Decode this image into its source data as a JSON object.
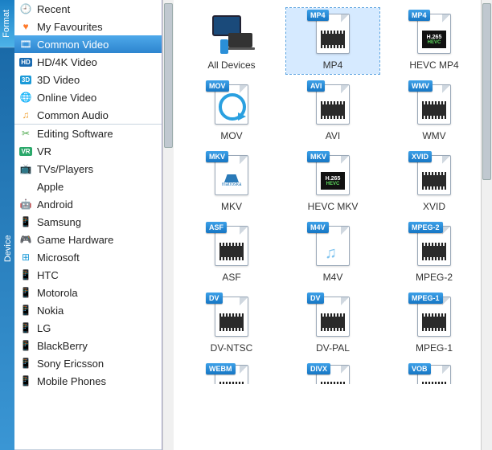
{
  "sidetabs": {
    "format": "Format",
    "device": "Device"
  },
  "format_items": [
    {
      "label": "Recent",
      "icon": "clock-icon",
      "color": "#f0a030"
    },
    {
      "label": "My Favourites",
      "icon": "heart-icon",
      "color": "#ff7a2a"
    },
    {
      "label": "Common Video",
      "icon": "film-icon",
      "color": "#ffffff",
      "selected": true
    },
    {
      "label": "HD/4K Video",
      "icon": "hd-badge-icon",
      "color": "#1a6ab0",
      "badge": "HD"
    },
    {
      "label": "3D Video",
      "icon": "3d-badge-icon",
      "color": "#1a9ad8",
      "badge": "3D"
    },
    {
      "label": "Online Video",
      "icon": "globe-icon",
      "color": "#e04a3a"
    },
    {
      "label": "Common Audio",
      "icon": "music-icon",
      "color": "#f0a030"
    }
  ],
  "device_items": [
    {
      "label": "Editing Software",
      "icon": "scissors-icon",
      "color": "#4aa84a"
    },
    {
      "label": "VR",
      "icon": "vr-badge-icon",
      "color": "#2aa86a",
      "badge": "VR"
    },
    {
      "label": "TVs/Players",
      "icon": "tv-icon",
      "color": "#f0a030"
    },
    {
      "label": "Apple",
      "icon": "apple-icon",
      "color": "#555"
    },
    {
      "label": "Android",
      "icon": "android-icon",
      "color": "#7cb342"
    },
    {
      "label": "Samsung",
      "icon": "phone-icon",
      "color": "#1a4a8a"
    },
    {
      "label": "Game Hardware",
      "icon": "gamepad-icon",
      "color": "#777"
    },
    {
      "label": "Microsoft",
      "icon": "windows-icon",
      "color": "#1a9ad8"
    },
    {
      "label": "HTC",
      "icon": "phone-icon",
      "color": "#222"
    },
    {
      "label": "Motorola",
      "icon": "phone-icon",
      "color": "#222"
    },
    {
      "label": "Nokia",
      "icon": "phone-icon",
      "color": "#1a5a9a"
    },
    {
      "label": "LG",
      "icon": "phone-icon",
      "color": "#222"
    },
    {
      "label": "BlackBerry",
      "icon": "phone-icon",
      "color": "#222"
    },
    {
      "label": "Sony Ericsson",
      "icon": "phone-icon",
      "color": "#1a5a9a"
    },
    {
      "label": "Mobile Phones",
      "icon": "phone-icon",
      "color": "#1a5a9a"
    }
  ],
  "formats": [
    {
      "label": "All Devices",
      "tag": "",
      "kind": "alldevices"
    },
    {
      "label": "MP4",
      "tag": "MP4",
      "kind": "film",
      "selected": true
    },
    {
      "label": "HEVC MP4",
      "tag": "MP4",
      "kind": "hevc"
    },
    {
      "label": "MOV",
      "tag": "MOV",
      "kind": "qt"
    },
    {
      "label": "AVI",
      "tag": "AVI",
      "kind": "film"
    },
    {
      "label": "WMV",
      "tag": "WMV",
      "kind": "film"
    },
    {
      "label": "MKV",
      "tag": "MKV",
      "kind": "mkv"
    },
    {
      "label": "HEVC MKV",
      "tag": "MKV",
      "kind": "hevc"
    },
    {
      "label": "XVID",
      "tag": "XVID",
      "kind": "film"
    },
    {
      "label": "ASF",
      "tag": "ASF",
      "kind": "film"
    },
    {
      "label": "M4V",
      "tag": "M4V",
      "kind": "note"
    },
    {
      "label": "MPEG-2",
      "tag": "MPEG-2",
      "kind": "film"
    },
    {
      "label": "DV-NTSC",
      "tag": "DV",
      "kind": "film"
    },
    {
      "label": "DV-PAL",
      "tag": "DV",
      "kind": "film"
    },
    {
      "label": "MPEG-1",
      "tag": "MPEG-1",
      "kind": "film"
    },
    {
      "label": "",
      "tag": "WEBM",
      "kind": "film",
      "partial": true
    },
    {
      "label": "",
      "tag": "DIVX",
      "kind": "film",
      "partial": true
    },
    {
      "label": "",
      "tag": "VOB",
      "kind": "film",
      "partial": true
    }
  ],
  "hevc_text": {
    "top": "H.265",
    "bot": "HEVC"
  },
  "mkv_text": "matroska"
}
